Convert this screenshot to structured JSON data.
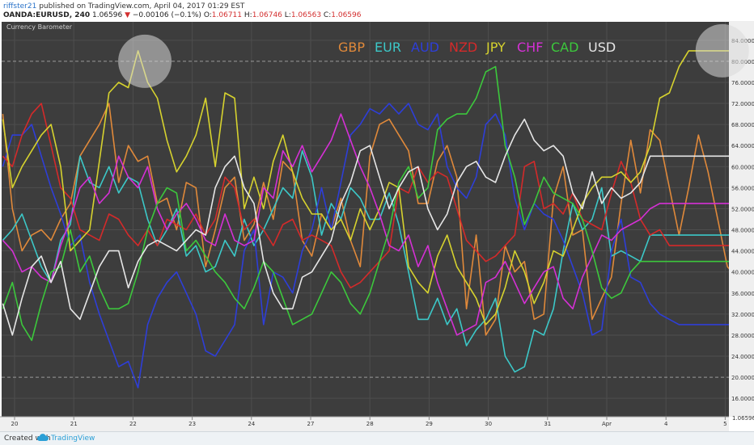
{
  "header": {
    "author": "riffster21",
    "published_text": "published on TradingView.com, April 04, 2017 01:29 EST",
    "symbol": "OANDA:EURUSD, 240",
    "price": "1.06596",
    "change": "−0.00106 (−0.1%)",
    "o_label": "O:",
    "o_value": "1.06711",
    "h_label": "H:",
    "h_value": "1.06746",
    "l_label": "L:",
    "l_value": "1.06563",
    "c_label": "C:",
    "c_value": "1.06596"
  },
  "footer": {
    "created_text": "Created with",
    "brand": "TradingView",
    "logo_icon": "tradingview-cloud-icon"
  },
  "colors": {
    "chart_bg": "#3d3d3d",
    "grid": "#4e4e4e",
    "dashed_grid": "#9a9a9a",
    "axis_bg": "#efefef",
    "axis_text": "#333333"
  },
  "chart_data": {
    "type": "line",
    "indicator_name": "Currency Barometer",
    "x_ticks": [
      "20",
      "21",
      "22",
      "23",
      "24",
      "27",
      "28",
      "29",
      "30",
      "31",
      "Apr",
      "4",
      "5"
    ],
    "y_ticks": [
      "16.0000",
      "20.0000",
      "24.0000",
      "28.0000",
      "32.0000",
      "36.0000",
      "40.0000",
      "44.0000",
      "48.0000",
      "52.0000",
      "56.0000",
      "60.0000",
      "64.0000",
      "68.0000",
      "72.0000",
      "76.0000",
      "80.0000",
      "84.0000"
    ],
    "dashed_levels": [
      20,
      30,
      50,
      70,
      80
    ],
    "ylim": [
      12.5,
      87.5
    ],
    "price_label": "1.06596",
    "grid": true,
    "legend_placement": "top-right",
    "highlights": [
      {
        "x": 2.2,
        "y": 80
      },
      {
        "x": 11.95,
        "y": 82
      }
    ],
    "series": [
      {
        "name": "GBP",
        "color": "#e0893a",
        "x_start": -0.2,
        "x_end": 12.2,
        "values": [
          70,
          52,
          44,
          47,
          48,
          46,
          50,
          53,
          62,
          65,
          68,
          72,
          57,
          64,
          61,
          62,
          53,
          54,
          48,
          57,
          56,
          41,
          48,
          56,
          58,
          46,
          49,
          57,
          50,
          61,
          59,
          46,
          43,
          51,
          48,
          54,
          46,
          41,
          62,
          68,
          69,
          66,
          63,
          53,
          53,
          61,
          64,
          58,
          33,
          47,
          28,
          31,
          45,
          40,
          42,
          31,
          32,
          54,
          60,
          47,
          48,
          31,
          35,
          39,
          53,
          65,
          55,
          67,
          65,
          56,
          47,
          56,
          66,
          59,
          50,
          41,
          39
        ]
      },
      {
        "name": "EUR",
        "color": "#3cc8c8",
        "x_start": -0.2,
        "x_end": 12.2,
        "values": [
          46,
          48,
          51,
          46,
          41,
          38,
          46,
          49,
          62,
          57,
          56,
          60,
          55,
          58,
          57,
          50,
          45,
          48,
          52,
          43,
          45,
          40,
          41,
          46,
          43,
          50,
          45,
          48,
          52,
          56,
          54,
          63,
          58,
          47,
          53,
          50,
          56,
          54,
          50,
          50,
          55,
          49,
          40,
          31,
          31,
          35,
          30,
          33,
          26,
          29,
          31,
          35,
          24,
          21,
          22,
          29,
          28,
          33,
          44,
          53,
          48,
          50,
          56,
          43,
          44,
          43,
          42,
          47,
          47,
          47,
          47,
          47,
          47,
          47,
          47,
          47,
          47
        ]
      },
      {
        "name": "AUD",
        "color": "#2e3ed8",
        "x_start": -0.2,
        "x_end": 12.2,
        "values": [
          60,
          66,
          66,
          68,
          62,
          56,
          51,
          45,
          47,
          38,
          32,
          27,
          22,
          23,
          18,
          30,
          35,
          38,
          40,
          36,
          32,
          25,
          24,
          27,
          30,
          44,
          48,
          30,
          40,
          39,
          36,
          44,
          48,
          56,
          48,
          57,
          66,
          68,
          71,
          70,
          72,
          70,
          72,
          68,
          67,
          70,
          60,
          56,
          54,
          58,
          68,
          70,
          66,
          54,
          48,
          53,
          51,
          50,
          46,
          41,
          36,
          28,
          29,
          44,
          50,
          39,
          38,
          34,
          32,
          31,
          30,
          30,
          30,
          30,
          30,
          30,
          30
        ]
      },
      {
        "name": "NZD",
        "color": "#d42a2a",
        "x_start": -0.2,
        "x_end": 12.2,
        "values": [
          62,
          60,
          66,
          70,
          72,
          64,
          56,
          54,
          48,
          47,
          46,
          51,
          50,
          47,
          45,
          48,
          45,
          50,
          49,
          48,
          51,
          47,
          50,
          58,
          56,
          48,
          50,
          48,
          45,
          49,
          50,
          46,
          47,
          46,
          45,
          40,
          37,
          38,
          40,
          42,
          44,
          56,
          55,
          60,
          57,
          59,
          58,
          52,
          46,
          44,
          42,
          43,
          45,
          47,
          60,
          61,
          52,
          53,
          51,
          55,
          50,
          49,
          48,
          55,
          61,
          57,
          50,
          47,
          48,
          45,
          45,
          45,
          45,
          45,
          45,
          45,
          45
        ]
      },
      {
        "name": "JPY",
        "color": "#d6d22e",
        "x_start": -0.2,
        "x_end": 12.2,
        "values": [
          69,
          56,
          60,
          63,
          66,
          68,
          60,
          44,
          46,
          48,
          61,
          74,
          76,
          75,
          82,
          76,
          73,
          65,
          59,
          62,
          66,
          73,
          60,
          74,
          73,
          52,
          58,
          52,
          61,
          66,
          59,
          54,
          51,
          51,
          48,
          50,
          46,
          52,
          48,
          52,
          57,
          56,
          41,
          38,
          36,
          43,
          47,
          41,
          38,
          35,
          30,
          32,
          37,
          44,
          40,
          34,
          38,
          44,
          43,
          48,
          53,
          56,
          58,
          58,
          59,
          57,
          59,
          64,
          73,
          74,
          79,
          82,
          82,
          82,
          82,
          82,
          82
        ]
      },
      {
        "name": "CHF",
        "color": "#d530d5",
        "x_start": -0.2,
        "x_end": 12.2,
        "values": [
          46,
          44,
          40,
          41,
          39,
          38,
          45,
          50,
          56,
          58,
          53,
          55,
          62,
          58,
          56,
          60,
          52,
          48,
          51,
          53,
          50,
          46,
          45,
          51,
          46,
          45,
          46,
          56,
          54,
          63,
          60,
          64,
          59,
          62,
          65,
          70,
          65,
          60,
          56,
          51,
          45,
          44,
          47,
          41,
          45,
          38,
          33,
          28,
          29,
          30,
          38,
          39,
          42,
          38,
          34,
          37,
          40,
          41,
          35,
          33,
          39,
          43,
          47,
          46,
          48,
          49,
          50,
          52,
          53,
          53,
          53,
          53,
          53,
          53,
          53,
          53,
          53
        ]
      },
      {
        "name": "CAD",
        "color": "#3cc83c",
        "x_start": -0.2,
        "x_end": 12.2,
        "values": [
          33,
          38,
          30,
          27,
          34,
          40,
          41,
          48,
          40,
          43,
          37,
          33,
          33,
          34,
          40,
          48,
          53,
          56,
          55,
          44,
          46,
          43,
          40,
          38,
          35,
          33,
          37,
          42,
          40,
          35,
          30,
          31,
          32,
          36,
          40,
          38,
          34,
          32,
          36,
          42,
          48,
          57,
          60,
          54,
          56,
          67,
          69,
          70,
          70,
          73,
          78,
          79,
          64,
          58,
          49,
          53,
          58,
          55,
          54,
          53,
          50,
          44,
          37,
          35,
          36,
          40,
          42,
          42,
          42,
          42,
          42,
          42,
          42,
          42,
          42,
          42,
          42
        ]
      },
      {
        "name": "USD",
        "color": "#e6e6e6",
        "x_start": -0.2,
        "x_end": 12.2,
        "values": [
          34,
          28,
          35,
          41,
          43,
          38,
          42,
          33,
          31,
          36,
          41,
          44,
          44,
          37,
          42,
          45,
          46,
          45,
          44,
          46,
          48,
          47,
          56,
          60,
          62,
          56,
          53,
          42,
          36,
          33,
          33,
          39,
          40,
          43,
          46,
          53,
          57,
          63,
          64,
          58,
          52,
          56,
          59,
          60,
          52,
          48,
          51,
          57,
          60,
          61,
          58,
          57,
          62,
          66,
          69,
          65,
          63,
          64,
          62,
          55,
          52,
          59,
          53,
          56,
          54,
          55,
          57,
          62,
          62,
          62,
          62,
          62,
          62,
          62,
          62,
          62,
          62
        ]
      }
    ]
  }
}
